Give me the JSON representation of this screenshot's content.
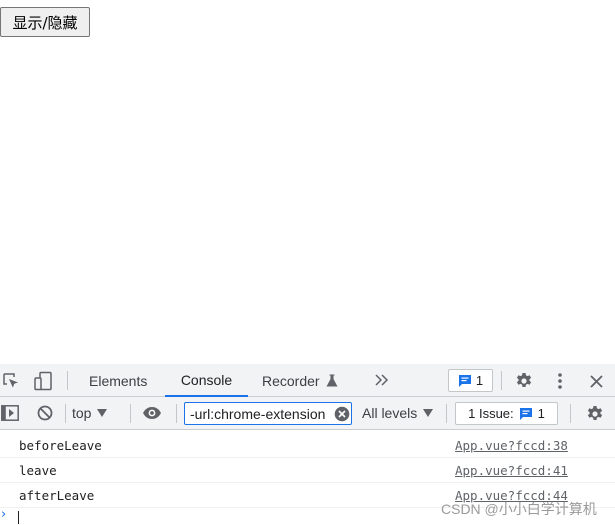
{
  "page": {
    "toggle_button_label": "显示/隐藏"
  },
  "devtools": {
    "tabs": [
      {
        "label": "Elements"
      },
      {
        "label": "Console"
      },
      {
        "label": "Recorder"
      }
    ],
    "active_tab": "Console",
    "issues_badge_count": "1",
    "toolbar": {
      "context_label": "top",
      "filter_value": "-url:chrome-extension",
      "levels_label": "All levels",
      "issues_label": "1 Issue:",
      "issues_count": "1"
    },
    "logs": [
      {
        "message": "beforeLeave",
        "source": "App.vue?fccd:38"
      },
      {
        "message": "leave",
        "source": "App.vue?fccd:41"
      },
      {
        "message": "afterLeave",
        "source": "App.vue?fccd:44"
      }
    ],
    "prompt_symbol": "›"
  },
  "watermark": "CSDN @小小白学计算机",
  "colors": {
    "accent": "#1a73e8",
    "toolbar_bg": "#f1f3f4",
    "text": "#202124"
  }
}
